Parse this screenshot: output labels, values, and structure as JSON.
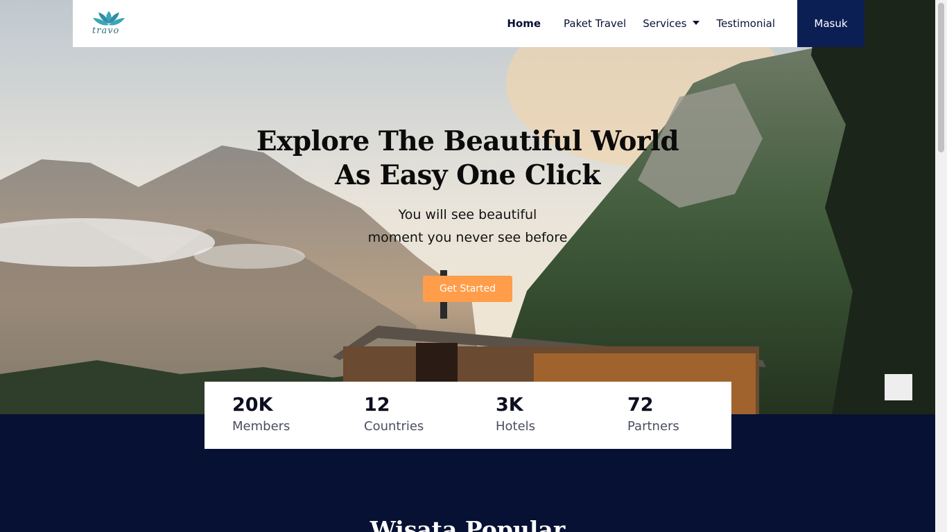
{
  "brand": {
    "name": "travo"
  },
  "nav": {
    "links": [
      {
        "label": "Home",
        "active": true
      },
      {
        "label": "Paket Travel"
      },
      {
        "label": "Services",
        "dropdown": true
      },
      {
        "label": "Testimonial"
      }
    ],
    "login_label": "Masuk"
  },
  "hero": {
    "title_line1": "Explore The Beautiful World",
    "title_line2": "As Easy One Click",
    "subtitle_line1": "You will see beautiful",
    "subtitle_line2": "moment you never see before",
    "cta_label": "Get Started"
  },
  "stats": [
    {
      "value": "20K",
      "label": "Members"
    },
    {
      "value": "12",
      "label": "Countries"
    },
    {
      "value": "3K",
      "label": "Hotels"
    },
    {
      "value": "72",
      "label": "Partners"
    }
  ],
  "section": {
    "title": "Wisata Popular"
  },
  "colors": {
    "navy": "#071133",
    "button_navy": "#0c1f55",
    "accent": "#ff9d4a"
  }
}
